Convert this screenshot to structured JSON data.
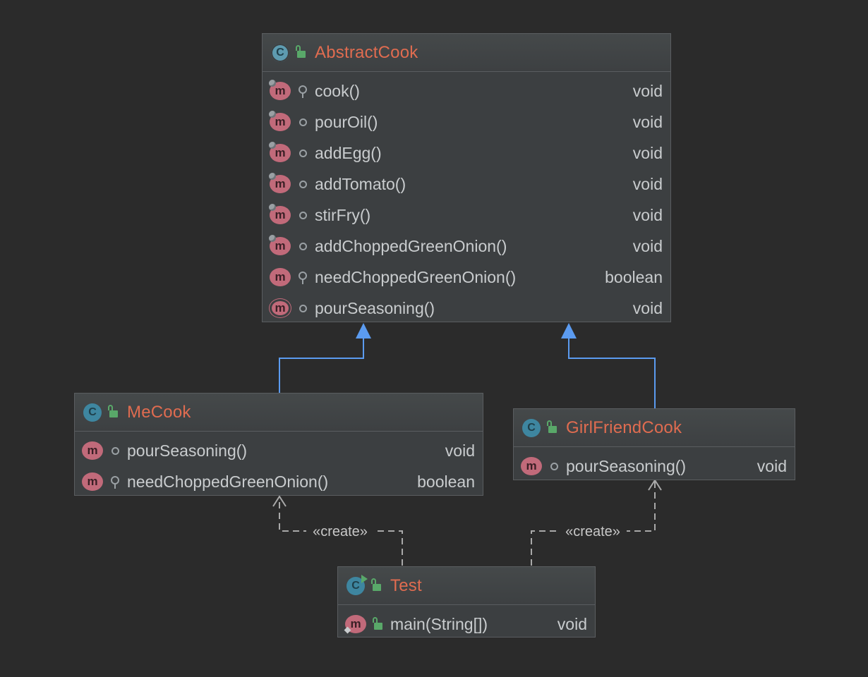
{
  "colors": {
    "background": "#2b2b2b",
    "class_name": "#e06c50",
    "inheritance_edge": "#5b9bf0",
    "dependency_edge": "#a9a9a9"
  },
  "classes": {
    "abstract_cook": {
      "name": "AbstractCook",
      "icon": "abstract-class-icon",
      "methods": [
        {
          "name": "cook()",
          "type": "void",
          "visibility": "protected",
          "abstract": true
        },
        {
          "name": "pourOil()",
          "type": "void",
          "visibility": "package",
          "abstract": true
        },
        {
          "name": "addEgg()",
          "type": "void",
          "visibility": "package",
          "abstract": true
        },
        {
          "name": "addTomato()",
          "type": "void",
          "visibility": "package",
          "abstract": true
        },
        {
          "name": "stirFry()",
          "type": "void",
          "visibility": "package",
          "abstract": true
        },
        {
          "name": "addChoppedGreenOnion()",
          "type": "void",
          "visibility": "package",
          "abstract": true
        },
        {
          "name": "needChoppedGreenOnion()",
          "type": "boolean",
          "visibility": "protected",
          "abstract": false
        },
        {
          "name": "pourSeasoning()",
          "type": "void",
          "visibility": "package",
          "abstract": true
        }
      ]
    },
    "me_cook": {
      "name": "MeCook",
      "icon": "class-icon",
      "methods": [
        {
          "name": "pourSeasoning()",
          "type": "void",
          "visibility": "package"
        },
        {
          "name": "needChoppedGreenOnion()",
          "type": "boolean",
          "visibility": "protected"
        }
      ]
    },
    "girl_friend_cook": {
      "name": "GirlFriendCook",
      "icon": "class-icon",
      "methods": [
        {
          "name": "pourSeasoning()",
          "type": "void",
          "visibility": "package"
        }
      ]
    },
    "test": {
      "name": "Test",
      "icon": "runnable-class-icon",
      "methods": [
        {
          "name": "main(String[])",
          "type": "void",
          "visibility": "public",
          "static": true
        }
      ]
    }
  },
  "edges": [
    {
      "from": "MeCook",
      "to": "AbstractCook",
      "kind": "inheritance"
    },
    {
      "from": "GirlFriendCook",
      "to": "AbstractCook",
      "kind": "inheritance"
    },
    {
      "from": "Test",
      "to": "MeCook",
      "kind": "dependency",
      "label": "«create»"
    },
    {
      "from": "Test",
      "to": "GirlFriendCook",
      "kind": "dependency",
      "label": "«create»"
    }
  ]
}
